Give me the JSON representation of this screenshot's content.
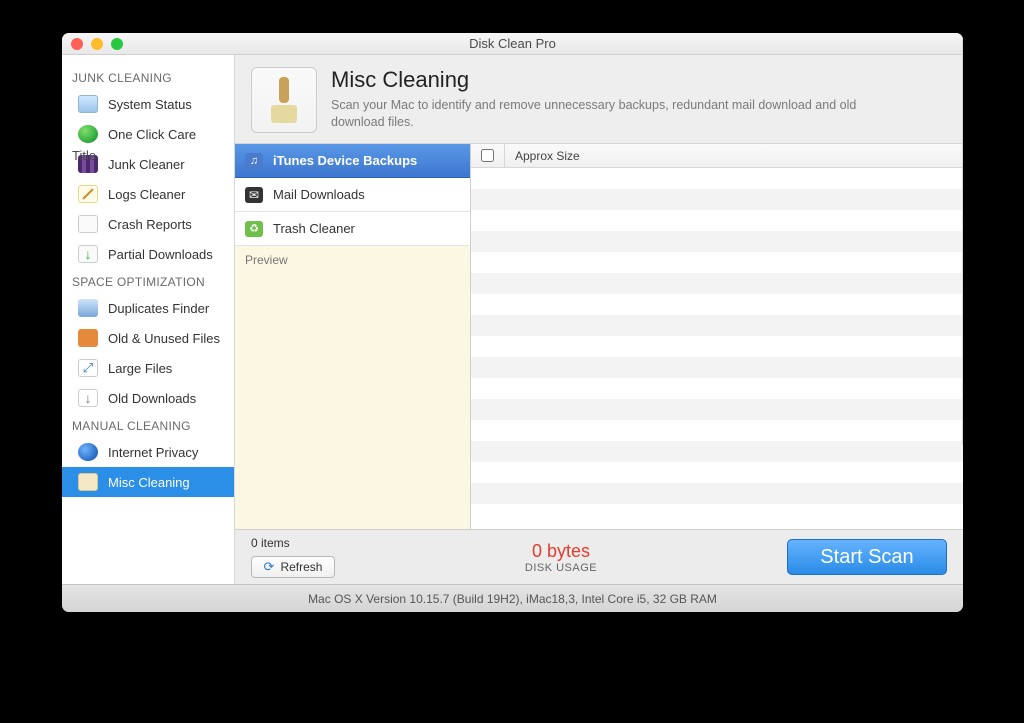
{
  "window": {
    "title": "Disk Clean Pro"
  },
  "sidebar": {
    "sections": [
      {
        "header": "JUNK CLEANING",
        "items": [
          {
            "label": "System Status"
          },
          {
            "label": "One Click Care"
          },
          {
            "label": "Junk Cleaner"
          },
          {
            "label": "Logs Cleaner"
          },
          {
            "label": "Crash Reports"
          },
          {
            "label": "Partial Downloads"
          }
        ]
      },
      {
        "header": "SPACE OPTIMIZATION",
        "items": [
          {
            "label": "Duplicates Finder"
          },
          {
            "label": "Old & Unused Files"
          },
          {
            "label": "Large Files"
          },
          {
            "label": "Old Downloads"
          }
        ]
      },
      {
        "header": "MANUAL CLEANING",
        "items": [
          {
            "label": "Internet Privacy"
          },
          {
            "label": "Misc Cleaning"
          }
        ]
      }
    ]
  },
  "main": {
    "title": "Misc Cleaning",
    "subtitle": "Scan your Mac to identify and remove unnecessary backups, redundant mail download and old download files.",
    "categories": [
      {
        "label": "iTunes Device Backups"
      },
      {
        "label": "Mail Downloads"
      },
      {
        "label": "Trash Cleaner"
      }
    ],
    "preview_label": "Preview",
    "columns": {
      "title": "Title",
      "size": "Approx Size"
    }
  },
  "footer": {
    "items_text": "0 items",
    "refresh": "Refresh",
    "bytes": "0 bytes",
    "disk_usage": "DISK USAGE",
    "start_scan": "Start Scan"
  },
  "statusbar": "Mac OS X Version 10.15.7 (Build 19H2), iMac18,3, Intel Core i5, 32 GB RAM"
}
